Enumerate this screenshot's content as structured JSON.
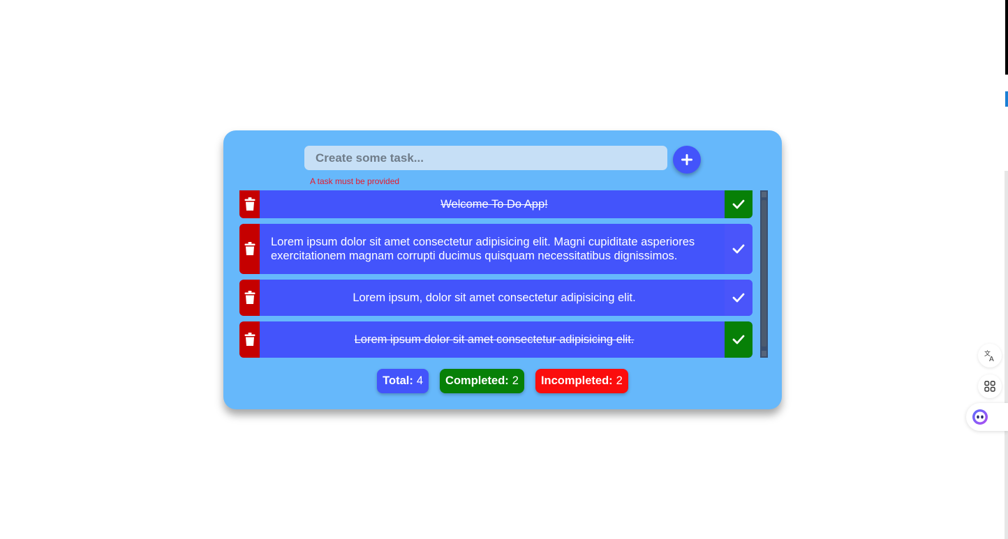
{
  "input": {
    "placeholder": "Create some task...",
    "value": ""
  },
  "add_button": {
    "icon": "plus-icon"
  },
  "error_message": "A task must be provided",
  "tasks": [
    {
      "text": "Welcome To Do App!",
      "completed": true
    },
    {
      "text": "Lorem ipsum dolor sit amet consectetur adipisicing elit. Magni cupiditate asperiores exercitationem magnam corrupti ducimus quisquam necessitatibus dignissimos.",
      "completed": false
    },
    {
      "text": "Lorem ipsum, dolor sit amet consectetur adipisicing elit.",
      "completed": false
    },
    {
      "text": "Lorem ipsum dolor sit amet consectetur adipisicing elit.",
      "completed": true
    }
  ],
  "stats": {
    "total_label": "Total:",
    "total_value": "4",
    "completed_label": "Completed:",
    "completed_value": "2",
    "incompleted_label": "Incompleted:",
    "incompleted_value": "2"
  },
  "colors": {
    "card": "#66b8fb",
    "task": "#4354fb",
    "delete": "#c50000",
    "done": "#078007",
    "incomplete": "#fb0d0d",
    "error_text": "#e8192c"
  },
  "side_icons": [
    "translate-icon",
    "apps-grid-icon",
    "assistant-icon"
  ]
}
